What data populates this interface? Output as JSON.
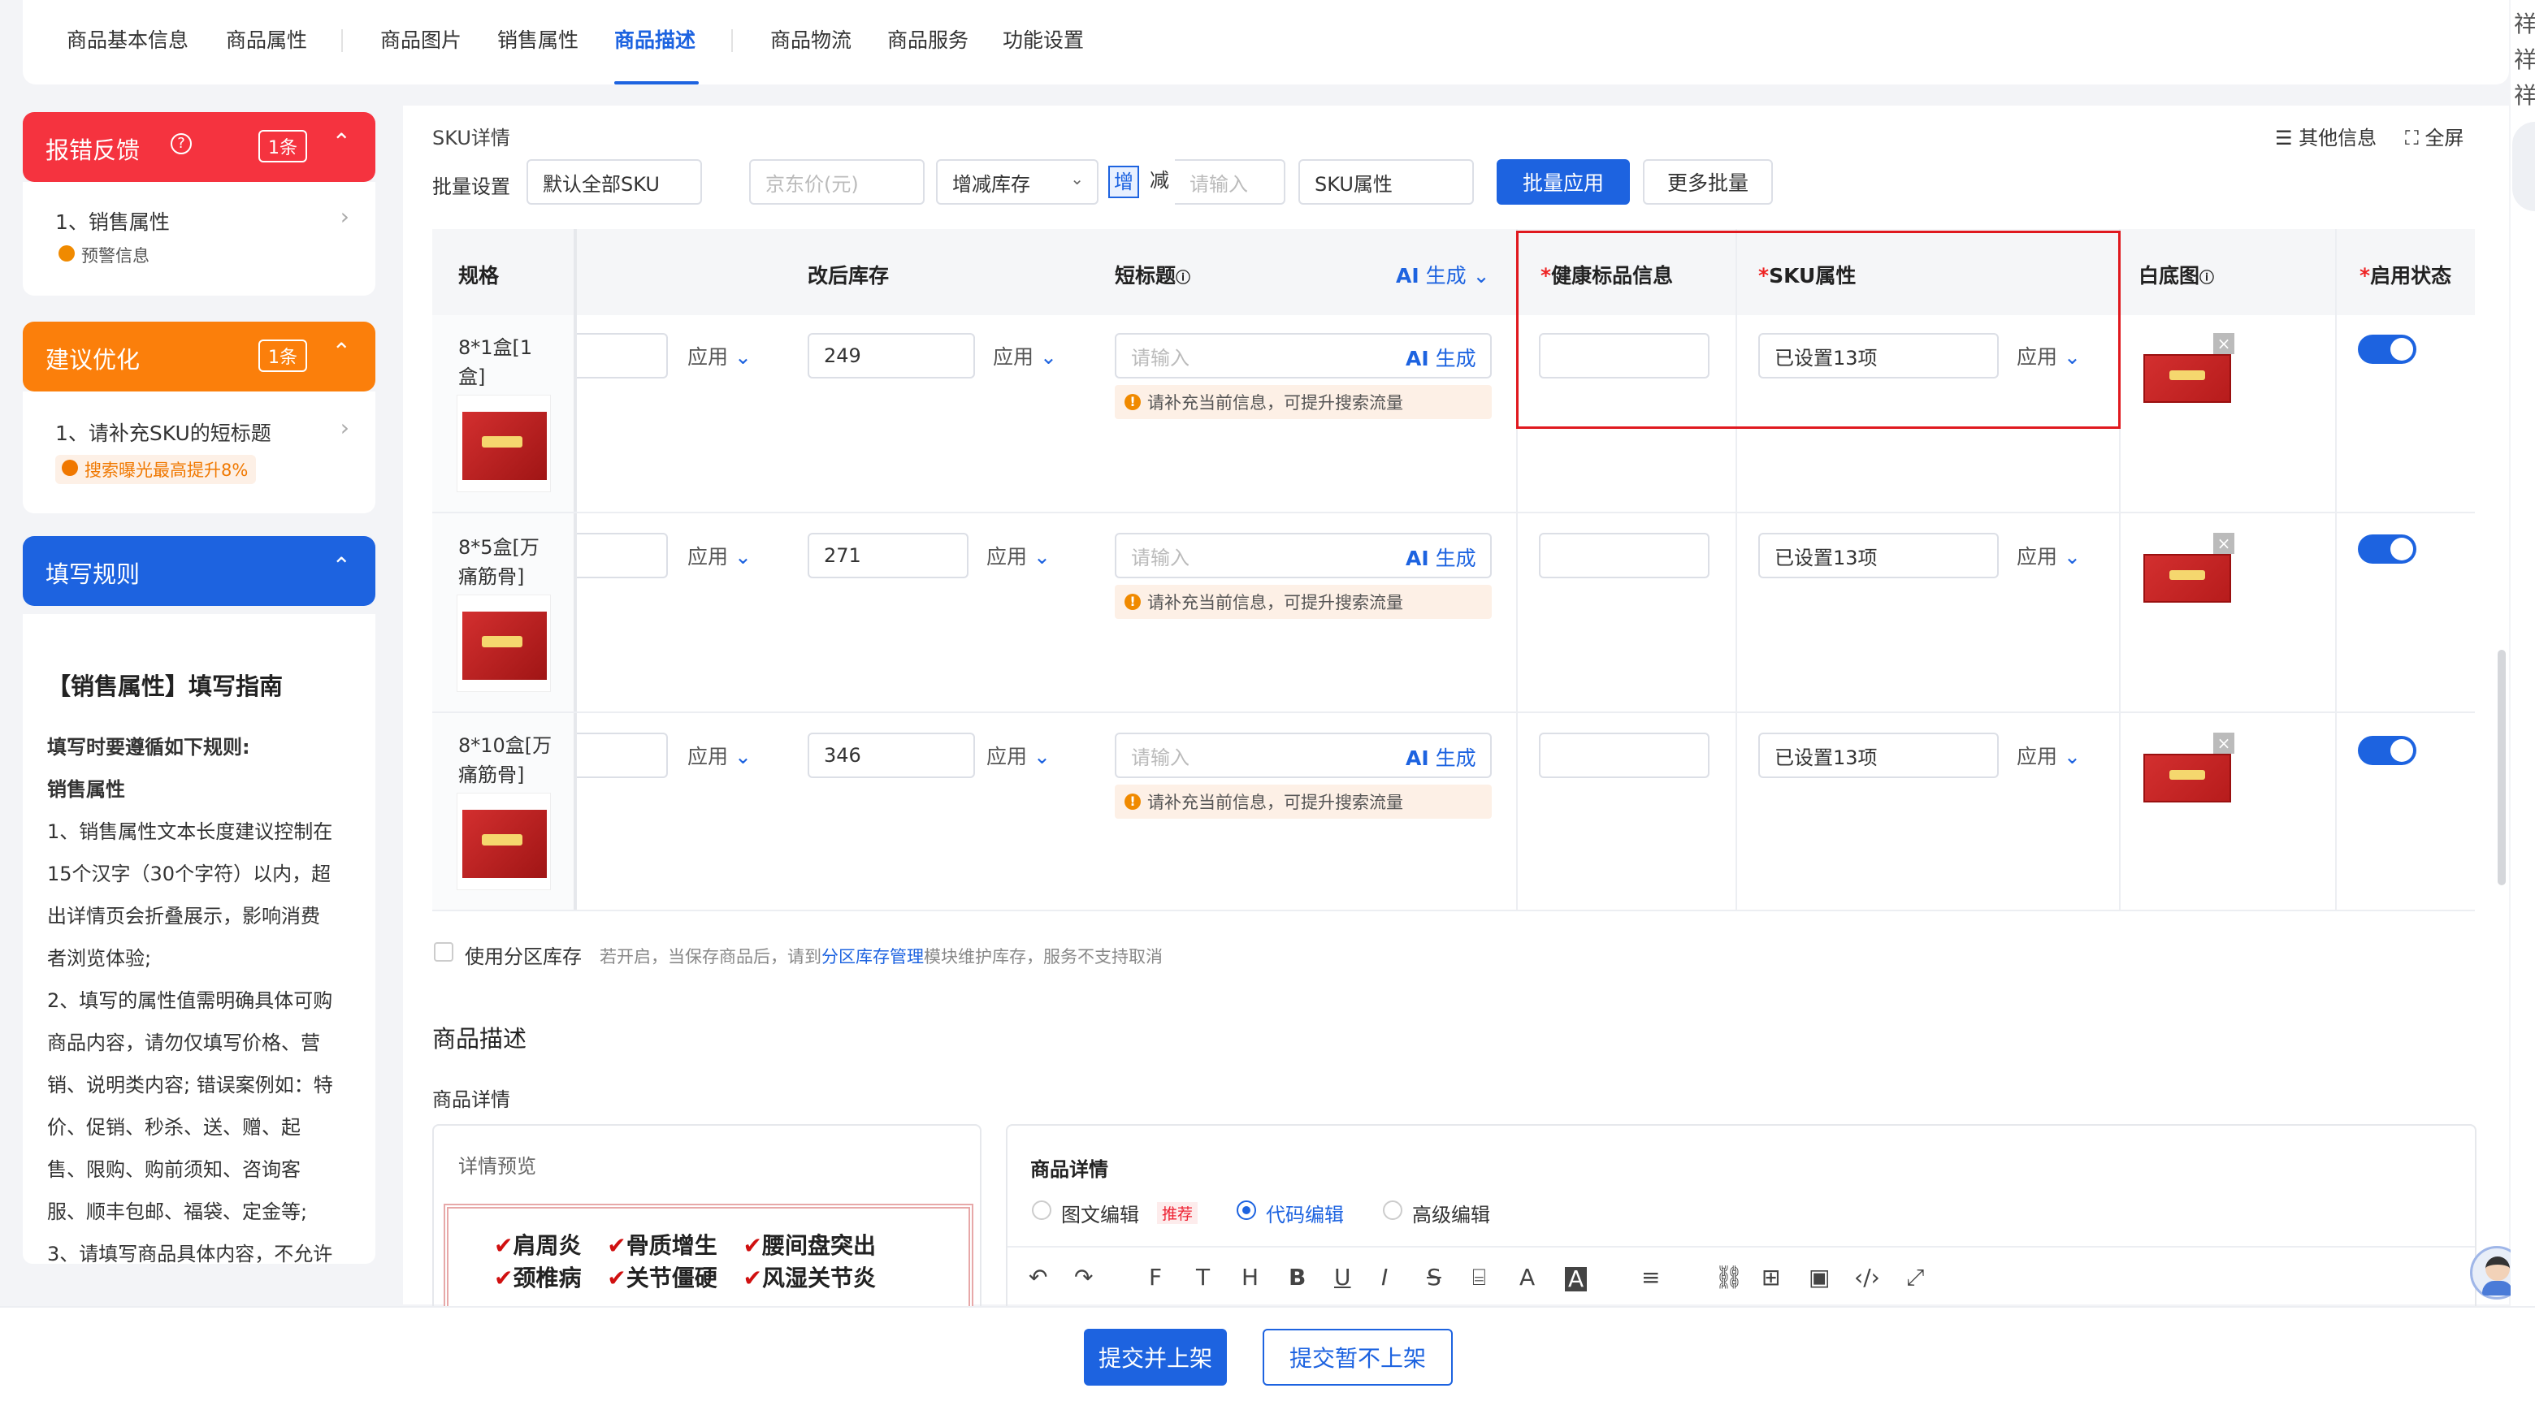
{
  "nav": {
    "tabs": [
      "商品基本信息",
      "商品属性",
      "商品图片",
      "销售属性",
      "商品描述",
      "商品物流",
      "商品服务",
      "功能设置"
    ],
    "active": "商品描述"
  },
  "left": {
    "error_card": {
      "title": "报错反馈",
      "count": "1条",
      "item": "1、销售属性",
      "tag": "预警信息"
    },
    "suggest_card": {
      "title": "建议优化",
      "count": "1条",
      "item": "1、请补充SKU的短标题",
      "tag": "搜索曝光最高提升8%"
    },
    "rules_card": {
      "title": "填写规则",
      "heading": "【销售属性】填写指南",
      "lines": [
        "填写时要遵循如下规则:",
        "销售属性",
        "1、销售属性文本长度建议控制在",
        "15个汉字（30个字符）以内，超",
        "出详情页会折叠展示，影响消费",
        "者浏览体验;",
        "2、填写的属性值需明确具体可购",
        "商品内容，请勿仅填写价格、营",
        "销、说明类内容; 错误案例如：特",
        "价、促销、秒杀、送、赠、起",
        "售、限购、购前须知、咨询客",
        "服、顺丰包邮、福袋、定金等;",
        "3、请填写商品具体内容，不允许"
      ]
    },
    "colors": {
      "error": "#f5333f",
      "suggest": "#fb7f0b",
      "rules": "#1d63e0"
    }
  },
  "sku": {
    "section_title": "SKU详情",
    "other_info": "其他信息",
    "fullscreen": "全屏",
    "batch_label": "批量设置",
    "batch_sku_select": "默认全部SKU",
    "price_placeholder": "京东价(元)",
    "stock_select": "增减库存",
    "add_label": "增",
    "sub_label": "减",
    "stock_input_placeholder": "请输入",
    "sku_attr_select": "SKU属性",
    "batch_apply_button": "批量应用",
    "more_batch_button": "更多批量",
    "columns": {
      "spec": "规格",
      "stock": "改后库存",
      "short_title": "短标题",
      "ai_gen_a": "AI",
      "ai_gen_b": "生成",
      "health": "健康标品信息",
      "sku_attr": "SKU属性",
      "white_img": "白底图",
      "status": "启用状态"
    },
    "apply_label": "应用",
    "short_title_placeholder": "请输入",
    "warn_text": "请补充当前信息，可提升搜索流量",
    "sku_attr_value": "已设置13项",
    "rows": [
      {
        "spec": "8*1盒[1盒]",
        "stock": "249",
        "enabled": true
      },
      {
        "spec": "8*5盒[万痛筋骨]",
        "stock": "271",
        "enabled": true
      },
      {
        "spec": "8*10盒[万痛筋骨]",
        "stock": "346",
        "enabled": true
      }
    ],
    "zone_stock_label": "使用分区库存",
    "zone_stock_hint_a": "若开启，当保存商品后，请到",
    "zone_stock_link": "分区库存管理",
    "zone_stock_hint_b": "模块维护库存，服务不支持取消"
  },
  "desc": {
    "section_title": "商品描述",
    "detail_label": "商品详情",
    "preview_label": "详情预览",
    "preview_lines": [
      [
        "肩周炎",
        "骨质增生",
        "腰间盘突出"
      ],
      [
        "颈椎病",
        "关节僵硬",
        "风湿关节炎"
      ]
    ],
    "editor_title": "商品详情",
    "modes": [
      "图文编辑",
      "代码编辑",
      "高级编辑"
    ],
    "recommend_tag": "推荐",
    "selected_mode": "代码编辑"
  },
  "toolbar_icons": [
    "undo-icon",
    "redo-icon",
    "font-icon",
    "text-icon",
    "heading-icon",
    "bold-icon",
    "underline-icon",
    "italic-icon",
    "strikethrough-icon",
    "format-icon",
    "font-color-icon",
    "bg-color-icon",
    "align-icon",
    "link-icon",
    "table-icon",
    "image-icon",
    "code-icon",
    "expand-icon"
  ],
  "footer": {
    "submit_button": "提交并上架",
    "submit_hold_button": "提交暂不上架"
  },
  "right_edge": {
    "chars": [
      "祥",
      "祥",
      "祥"
    ]
  }
}
